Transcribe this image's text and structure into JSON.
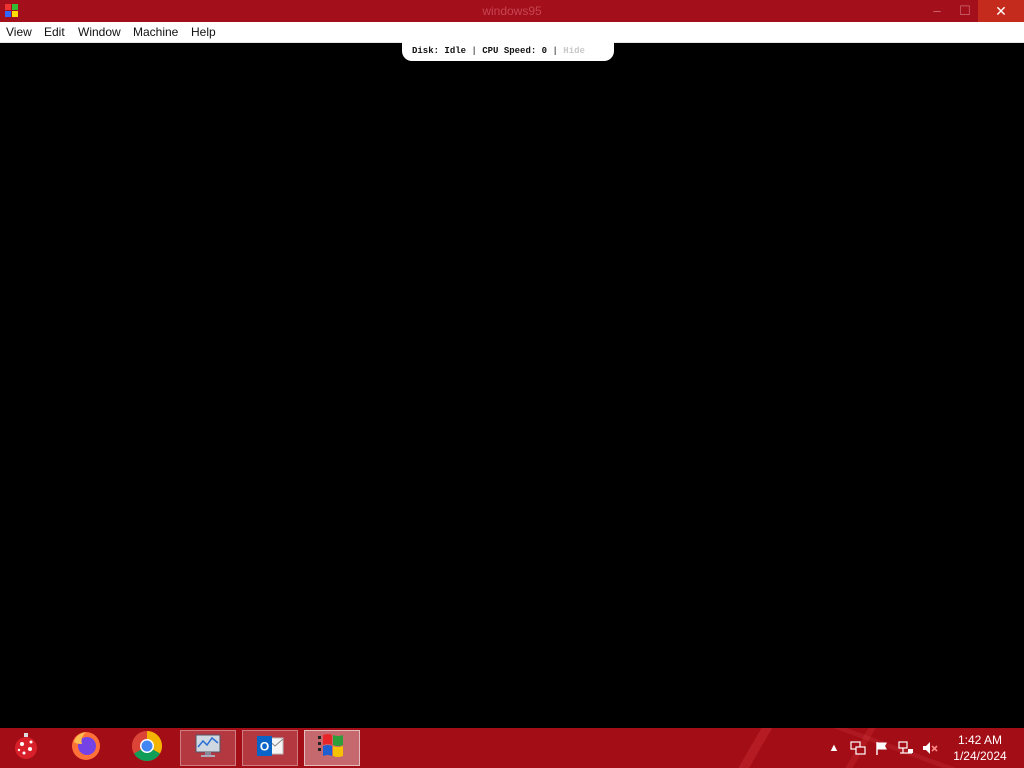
{
  "window": {
    "title": "windows95",
    "controls": {
      "minimize": "–",
      "maximize": "☐",
      "close": "✕"
    }
  },
  "menu": {
    "items": [
      "View",
      "Edit",
      "Window",
      "Machine",
      "Help"
    ]
  },
  "status": {
    "disk_label": "Disk:",
    "disk_value": "Idle",
    "cpu_label": "CPU Speed:",
    "cpu_value": "0",
    "separator": "|",
    "hide": "Hide"
  },
  "taskbar": {
    "apps": [
      {
        "name": "start-orb",
        "icon": "christmas-ornament-icon"
      },
      {
        "name": "firefox",
        "icon": "firefox-icon"
      },
      {
        "name": "chrome",
        "icon": "chrome-icon"
      },
      {
        "name": "system-monitor",
        "icon": "monitor-icon"
      },
      {
        "name": "outlook",
        "icon": "outlook-icon"
      },
      {
        "name": "windows95",
        "icon": "windows95-icon"
      }
    ],
    "tray": {
      "overflow": "▲",
      "icons": [
        "network-pc-icon",
        "flag-icon",
        "network-icon",
        "volume-muted-icon"
      ]
    },
    "clock": {
      "time": "1:42 AM",
      "date": "1/24/2024"
    }
  },
  "colors": {
    "titlebar": "#a3101c",
    "taskbar": "#a30d16",
    "close_hover": "#c42b1c",
    "screen": "#000000"
  }
}
